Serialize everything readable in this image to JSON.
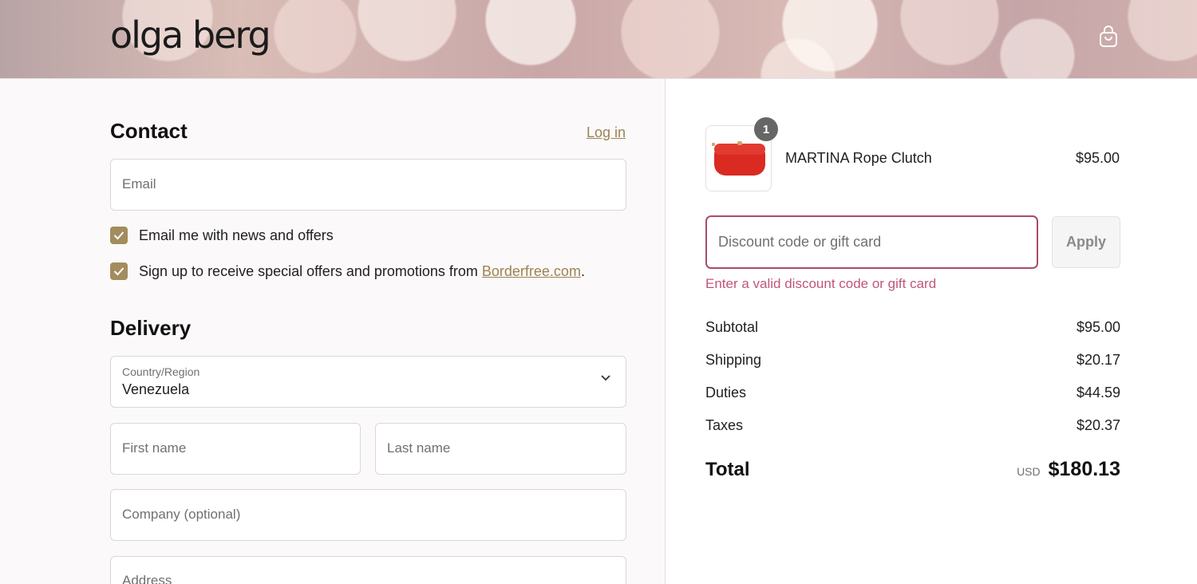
{
  "header": {
    "logo_text": "olga berg",
    "cart_icon": "shopping-bag-icon"
  },
  "contact": {
    "title": "Contact",
    "login_link": "Log in",
    "email_placeholder": "Email",
    "news_checkbox": {
      "label": "Email me with news and offers",
      "checked": true
    },
    "promo_checkbox": {
      "label_before": "Sign up to receive special offers and promotions from ",
      "link": "Borderfree.com",
      "label_after": ".",
      "checked": true
    }
  },
  "delivery": {
    "title": "Delivery",
    "country_label": "Country/Region",
    "country_value": "Venezuela",
    "first_name_placeholder": "First name",
    "last_name_placeholder": "Last name",
    "company_placeholder": "Company (optional)",
    "address_placeholder": "Address"
  },
  "order": {
    "item": {
      "name": "MARTINA Rope Clutch",
      "price": "$95.00",
      "quantity": "1",
      "image": "red-clutch-image"
    },
    "discount_placeholder": "Discount code or gift card",
    "apply_label": "Apply",
    "error_text": "Enter a valid discount code or gift card",
    "summary": [
      {
        "label": "Subtotal",
        "value": "$95.00"
      },
      {
        "label": "Shipping",
        "value": "$20.17"
      },
      {
        "label": "Duties",
        "value": "$44.59"
      },
      {
        "label": "Taxes",
        "value": "$20.37"
      }
    ],
    "total_label": "Total",
    "currency": "USD",
    "total_value": "$180.13"
  },
  "colors": {
    "accent": "#a38c5e",
    "error": "#c0557b",
    "error_border": "#a84b6c"
  }
}
